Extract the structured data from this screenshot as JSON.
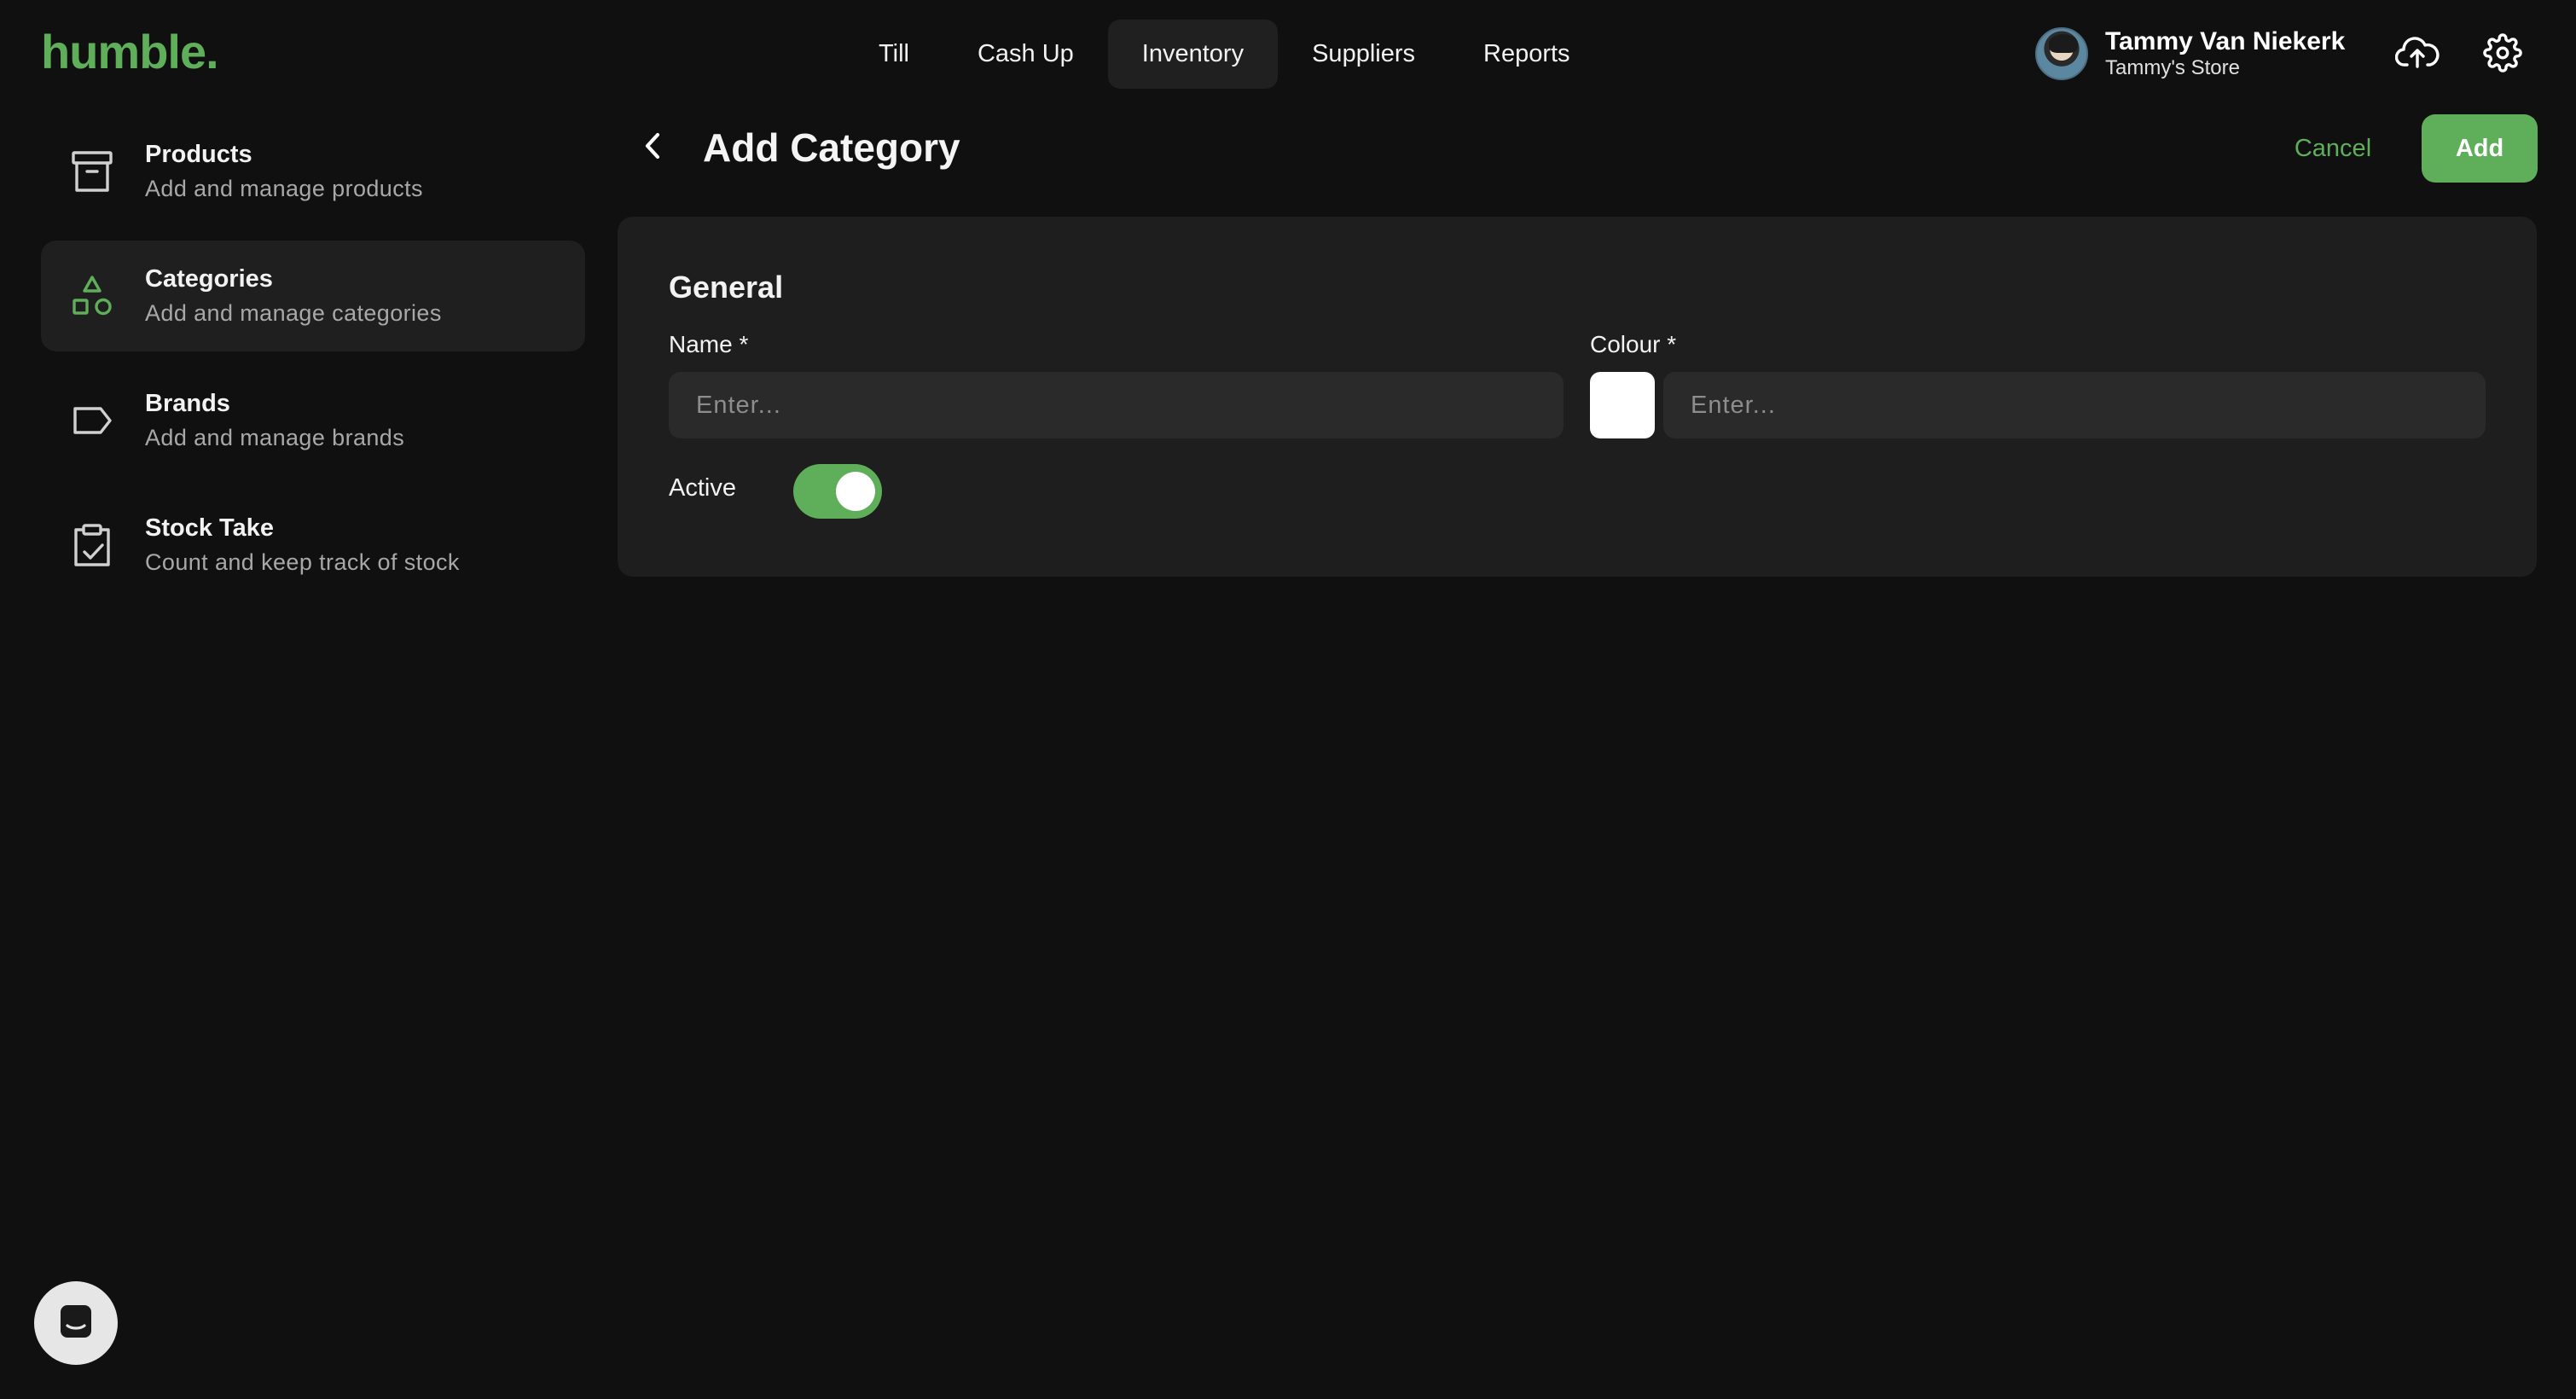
{
  "app": {
    "logo": "humble."
  },
  "topnav": {
    "tabs": [
      {
        "label": "Till",
        "active": false
      },
      {
        "label": "Cash Up",
        "active": false
      },
      {
        "label": "Inventory",
        "active": true
      },
      {
        "label": "Suppliers",
        "active": false
      },
      {
        "label": "Reports",
        "active": false
      }
    ]
  },
  "user": {
    "name": "Tammy Van Niekerk",
    "store": "Tammy's Store"
  },
  "icons": {
    "upload": "cloud-upload-icon",
    "settings": "gear-icon",
    "back": "chevron-left-icon",
    "chat": "chat-icon"
  },
  "sidebar": {
    "items": [
      {
        "title": "Products",
        "subtitle": "Add and manage products",
        "icon": "archive-box-icon",
        "active": false
      },
      {
        "title": "Categories",
        "subtitle": "Add and manage categories",
        "icon": "shapes-icon",
        "active": true
      },
      {
        "title": "Brands",
        "subtitle": "Add and manage brands",
        "icon": "tag-icon",
        "active": false
      },
      {
        "title": "Stock Take",
        "subtitle": "Count and keep track of stock",
        "icon": "clipboard-check-icon",
        "active": false
      }
    ]
  },
  "header": {
    "title": "Add Category",
    "cancel_label": "Cancel",
    "add_label": "Add"
  },
  "form": {
    "section_title": "General",
    "name_label": "Name *",
    "name_placeholder": "Enter...",
    "name_value": "",
    "colour_label": "Colour *",
    "colour_placeholder": "Enter...",
    "colour_value": "",
    "colour_swatch": "#ffffff",
    "active_label": "Active",
    "active_on": true
  },
  "colors": {
    "accent": "#5fae5a",
    "background": "#101010",
    "card": "#1e1e1e",
    "input": "#2a2a2a"
  }
}
